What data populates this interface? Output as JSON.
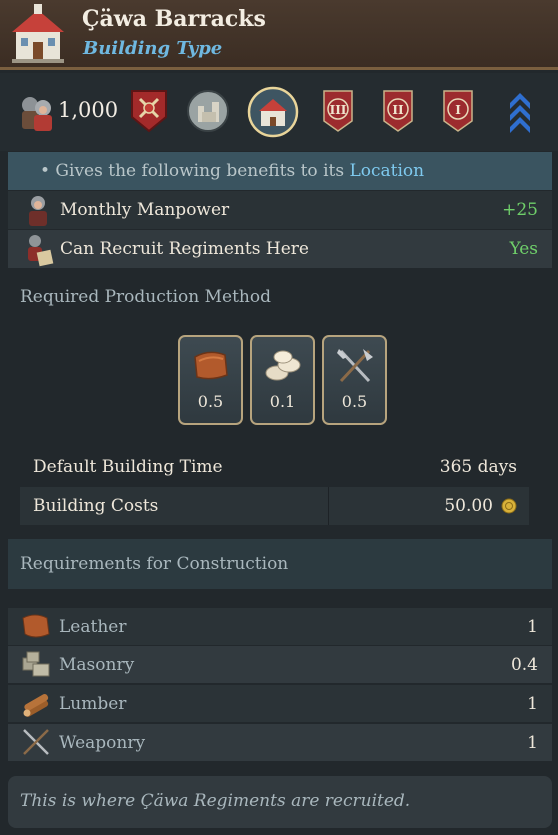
{
  "header": {
    "title": "Çäwa Barracks",
    "subtitle": "Building Type",
    "icon": "building-icon"
  },
  "icon_row": {
    "manpower_value": "1,000",
    "icons": [
      "manpower-icon",
      "shield-emblem-icon",
      "castle-icon",
      "building-selected-icon",
      "tier-III-icon",
      "tier-II-icon",
      "tier-I-icon",
      "rank-chevron-icon"
    ],
    "tier_labels": [
      "III",
      "II",
      "I"
    ]
  },
  "benefits": {
    "header_prefix": "• Gives the following benefits to its ",
    "header_link": "Location",
    "rows": [
      {
        "label": "Monthly Manpower",
        "value": "+25",
        "icon": "soldier-icon"
      },
      {
        "label": "Can Recruit Regiments Here",
        "value": "Yes",
        "icon": "recruit-icon"
      }
    ]
  },
  "production": {
    "label": "Required Production Method",
    "items": [
      {
        "icon": "leather-icon",
        "value": "0.5"
      },
      {
        "icon": "cloth-icon",
        "value": "0.1"
      },
      {
        "icon": "weaponry-icon",
        "value": "0.5"
      }
    ]
  },
  "building": {
    "time_label": "Default Building Time",
    "time_value": "365 days",
    "cost_label": "Building Costs",
    "cost_value": "50.00",
    "cost_icon": "gold-coin-icon"
  },
  "requirements": {
    "label": "Requirements for Construction",
    "rows": [
      {
        "label": "Leather",
        "value": "1",
        "icon": "leather-icon"
      },
      {
        "label": "Masonry",
        "value": "0.4",
        "icon": "masonry-icon"
      },
      {
        "label": "Lumber",
        "value": "1",
        "icon": "lumber-icon"
      },
      {
        "label": "Weaponry",
        "value": "1",
        "icon": "weaponry-icon"
      }
    ]
  },
  "footer": {
    "text": "This is where Çäwa Regiments are recruited."
  },
  "colors": {
    "accent_blue": "#6fb8e0",
    "positive_green": "#6fcf6a",
    "header_brown": "#3b2d23",
    "panel": "#22282c"
  }
}
